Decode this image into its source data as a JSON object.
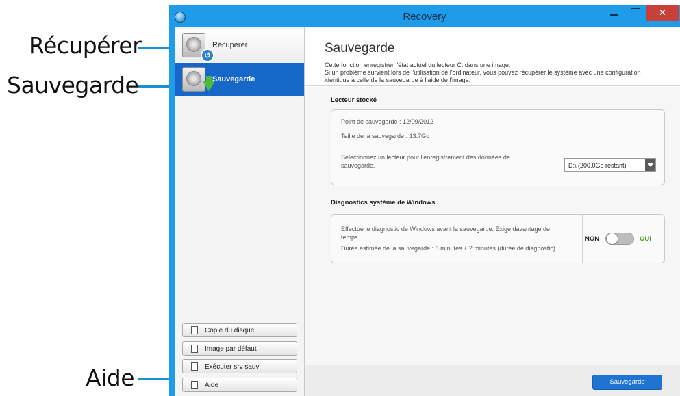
{
  "callouts": {
    "recuperer": "Récupérer",
    "sauvegarde": "Sauvegarde",
    "aide": "Aide"
  },
  "window": {
    "title": "Recovery",
    "close_glyph": "✕"
  },
  "sidebar": {
    "items": [
      {
        "label": "Récupérer",
        "icon": "restore-drive-icon",
        "selected": false
      },
      {
        "label": "Sauvegarde",
        "icon": "backup-drive-icon",
        "selected": true
      }
    ],
    "buttons": [
      {
        "label": "Copie du disque",
        "icon": "disk-copy-icon"
      },
      {
        "label": "Image par défaut",
        "icon": "default-image-icon"
      },
      {
        "label": "Exécuter srv sauv",
        "icon": "run-backup-icon"
      },
      {
        "label": "Aide",
        "icon": "help-icon"
      }
    ]
  },
  "main": {
    "title": "Sauvegarde",
    "description": [
      "Cette fonction enregistrer l'état actuel du lecteur C: dans une image.",
      "Si un problème survient lors de l'utilisation de l'ordinateur, vous pouvez récupérer le système avec une configuration",
      "identique à celle de la sauvegarde à l'aide de l'image."
    ],
    "storage": {
      "section_title": "Lecteur stocké",
      "backup_point": "Point de sauvegarde : 12/09/2012",
      "backup_size": "Taille de la sauvegarde : 13.7Go",
      "select_prompt_line1": "Sélectionnez un lecteur pour l'enregistrement des données de",
      "select_prompt_line2": "sauvegarde.",
      "selected_drive": "D:\\ (200.0Go restant)"
    },
    "diagnostics": {
      "section_title": "Diagnostics système de Windows",
      "line1": "Effectue le diagnostic de Windows avant la sauvegarde. Exige davantage de",
      "line2": "temps.",
      "line3": "Durée estimée de la sauvegarde : 8 minutes + 2 minutes (durée de diagnostic)",
      "toggle_off": "NON",
      "toggle_on": "OUI",
      "toggle_state": "off"
    },
    "footer": {
      "primary_button": "Sauvegarde"
    }
  },
  "colors": {
    "accent": "#1e9be9",
    "selected_nav": "#1767c8",
    "callout": "#1a8fd4",
    "toggle_on_label": "#4d9a23"
  }
}
